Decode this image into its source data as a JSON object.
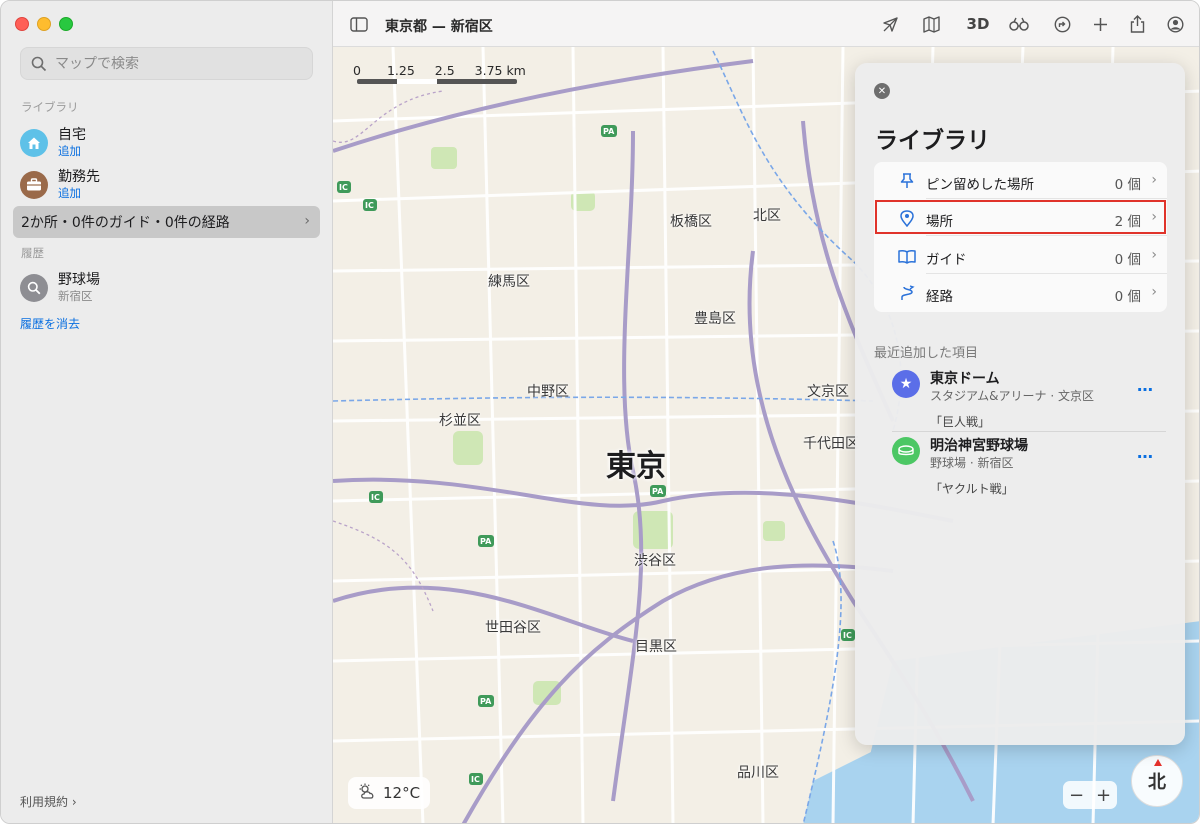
{
  "window": {
    "title": "東京都 — 新宿区"
  },
  "sidebar": {
    "search_placeholder": "マップで検索",
    "library_label": "ライブラリ",
    "home": {
      "title": "自宅",
      "action": "追加"
    },
    "work": {
      "title": "勤務先",
      "action": "追加"
    },
    "summary": "2か所・0件のガイド・0件の経路",
    "history_label": "履歴",
    "history_items": [
      {
        "title": "野球場",
        "subtitle": "新宿区"
      }
    ],
    "clear_history": "履歴を消去",
    "terms": "利用規約"
  },
  "toolbar": {
    "view_3d": "3D"
  },
  "map": {
    "scale_labels": [
      "0",
      "1.25",
      "2.5",
      "3.75 km"
    ],
    "city": "東京",
    "places": [
      {
        "name": "板橋区"
      },
      {
        "name": "北区"
      },
      {
        "name": "練馬区"
      },
      {
        "name": "豊島区"
      },
      {
        "name": "中野区"
      },
      {
        "name": "文京区"
      },
      {
        "name": "杉並区"
      },
      {
        "name": "千代田区"
      },
      {
        "name": "渋谷区"
      },
      {
        "name": "世田谷区"
      },
      {
        "name": "目黒区"
      },
      {
        "name": "品川区"
      }
    ],
    "weather": "12°C",
    "compass": "北",
    "zoom_out": "−",
    "zoom_in": "+"
  },
  "panel": {
    "title": "ライブラリ",
    "rows": [
      {
        "label": "ピン留めした場所",
        "count": "0 個",
        "icon": "pin-icon"
      },
      {
        "label": "場所",
        "count": "2 個",
        "icon": "location-icon"
      },
      {
        "label": "ガイド",
        "count": "0 個",
        "icon": "book-icon"
      },
      {
        "label": "経路",
        "count": "0 個",
        "icon": "route-icon"
      }
    ],
    "recent_label": "最近追加した項目",
    "recent": [
      {
        "title": "東京ドーム",
        "subtitle": "スタジアム&アリーナ · 文京区",
        "note": "「巨人戦」",
        "icon": "star-icon",
        "color": "#5b6ee8"
      },
      {
        "title": "明治神宮野球場",
        "subtitle": "野球場 · 新宿区",
        "note": "「ヤクルト戦」",
        "icon": "stadium-icon",
        "color": "#4cc764"
      }
    ],
    "more": "…"
  },
  "colors": {
    "accent": "#0a6fe0",
    "highlight_border": "#e0332a",
    "map_background": "#f3efe6"
  }
}
